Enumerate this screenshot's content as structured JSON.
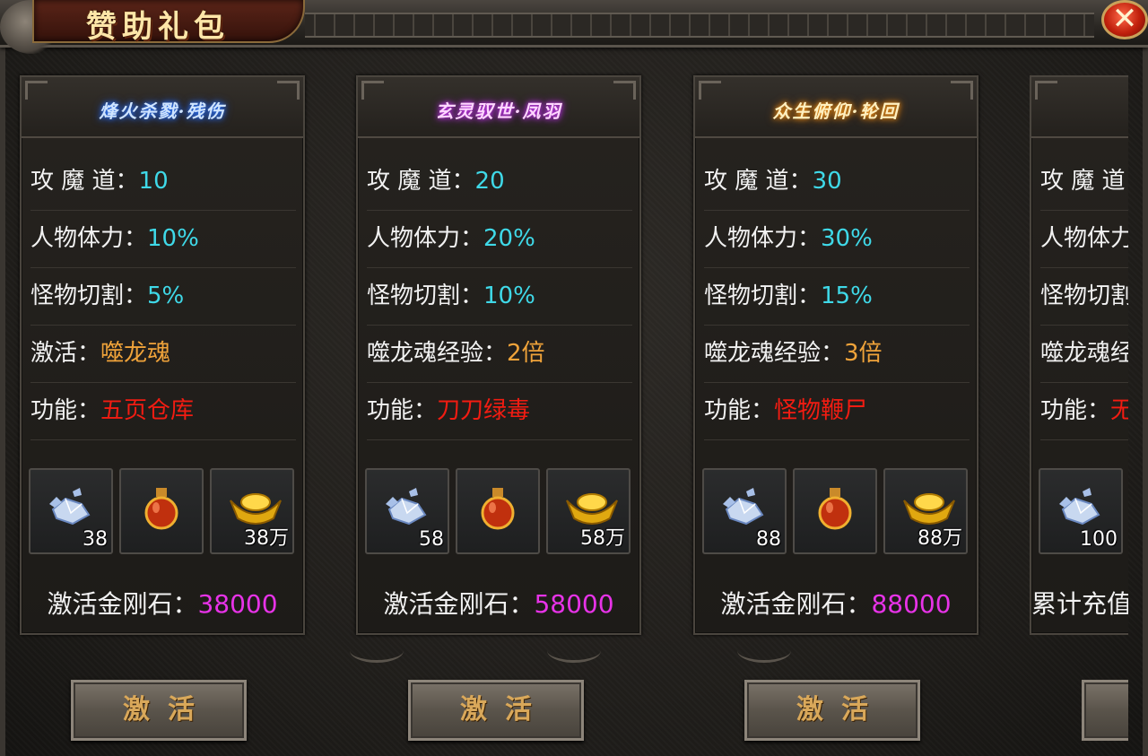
{
  "window": {
    "title": "赞助礼包",
    "close_label": "✕"
  },
  "cards": [
    {
      "title": "烽火杀戮·残伤",
      "title_glow": "#2e7bff",
      "stats": [
        {
          "label": "攻 魔 道：",
          "value": "10",
          "color": "cyan"
        },
        {
          "label": "人物体力：",
          "value": "10%",
          "color": "cyan"
        },
        {
          "label": "怪物切割：",
          "value": "5%",
          "color": "cyan"
        },
        {
          "label": "激活：",
          "value": "噬龙魂",
          "color": "orange"
        },
        {
          "label": "功能：",
          "value": "五页仓库",
          "color": "red"
        }
      ],
      "items": [
        {
          "icon": "diamond-icon",
          "qty": "38"
        },
        {
          "icon": "potion-icon",
          "qty": ""
        },
        {
          "icon": "gold-ingot-icon",
          "qty": "38万"
        }
      ],
      "cost_label": "激活金刚石：",
      "cost_value": "38000",
      "button_label": "激活"
    },
    {
      "title": "玄灵驭世·凤羽",
      "title_glow": "#d43cff",
      "stats": [
        {
          "label": "攻 魔 道：",
          "value": "20",
          "color": "cyan"
        },
        {
          "label": "人物体力：",
          "value": "20%",
          "color": "cyan"
        },
        {
          "label": "怪物切割：",
          "value": "10%",
          "color": "cyan"
        },
        {
          "label": "噬龙魂经验：",
          "value": "2倍",
          "color": "orange"
        },
        {
          "label": "功能：",
          "value": "刀刀绿毒",
          "color": "red"
        }
      ],
      "items": [
        {
          "icon": "diamond-icon",
          "qty": "58"
        },
        {
          "icon": "potion-icon",
          "qty": ""
        },
        {
          "icon": "gold-ingot-icon",
          "qty": "58万"
        }
      ],
      "cost_label": "激活金刚石：",
      "cost_value": "58000",
      "button_label": "激活"
    },
    {
      "title": "众生俯仰·轮回",
      "title_glow": "#ff9d1a",
      "stats": [
        {
          "label": "攻 魔 道：",
          "value": "30",
          "color": "cyan"
        },
        {
          "label": "人物体力：",
          "value": "30%",
          "color": "cyan"
        },
        {
          "label": "怪物切割：",
          "value": "15%",
          "color": "cyan"
        },
        {
          "label": "噬龙魂经验：",
          "value": "3倍",
          "color": "orange"
        },
        {
          "label": "功能：",
          "value": "怪物鞭尸",
          "color": "red"
        }
      ],
      "items": [
        {
          "icon": "diamond-icon",
          "qty": "88"
        },
        {
          "icon": "potion-icon",
          "qty": ""
        },
        {
          "icon": "gold-ingot-icon",
          "qty": "88万"
        }
      ],
      "cost_label": "激活金刚石：",
      "cost_value": "88000",
      "button_label": "激活"
    },
    {
      "title": "",
      "title_glow": "#ff3020",
      "stats": [
        {
          "label": "攻 魔 道",
          "value": "",
          "color": "cyan"
        },
        {
          "label": "人物体力",
          "value": "",
          "color": "cyan"
        },
        {
          "label": "怪物切割",
          "value": "",
          "color": "cyan"
        },
        {
          "label": "噬龙魂经",
          "value": "",
          "color": "orange"
        },
        {
          "label": "功能：",
          "value": "无",
          "color": "red"
        }
      ],
      "items": [
        {
          "icon": "diamond-icon",
          "qty": "100"
        }
      ],
      "cost_label": "累计充值",
      "cost_value": "",
      "button_label": ""
    }
  ],
  "colors": {
    "cyan": "#3fd9e8",
    "orange": "#f0a33a",
    "red": "#f21c12",
    "magenta": "#e733e7",
    "button_text": "#d9a85a"
  }
}
